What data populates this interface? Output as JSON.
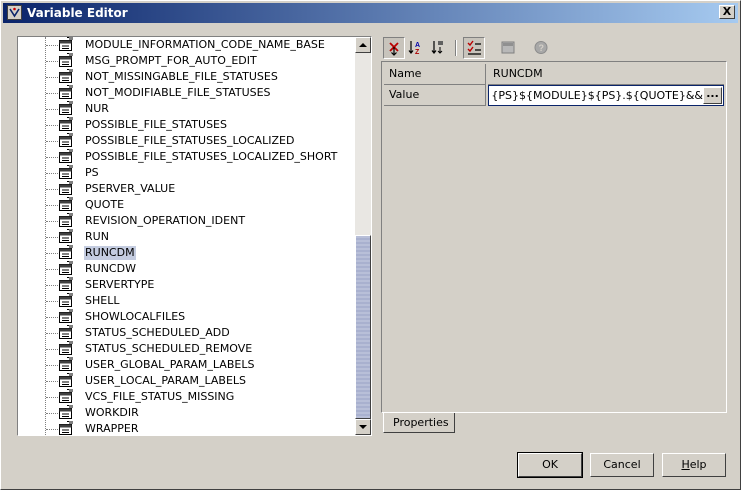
{
  "window": {
    "title": "Variable Editor",
    "close_glyph": "X"
  },
  "tree": {
    "items": [
      {
        "label": "MODULE_INFORMATION_CODE_NAME_BASE",
        "selected": false
      },
      {
        "label": "MSG_PROMPT_FOR_AUTO_EDIT",
        "selected": false
      },
      {
        "label": "NOT_MISSINGABLE_FILE_STATUSES",
        "selected": false
      },
      {
        "label": "NOT_MODIFIABLE_FILE_STATUSES",
        "selected": false
      },
      {
        "label": "NUR",
        "selected": false
      },
      {
        "label": "POSSIBLE_FILE_STATUSES",
        "selected": false
      },
      {
        "label": "POSSIBLE_FILE_STATUSES_LOCALIZED",
        "selected": false
      },
      {
        "label": "POSSIBLE_FILE_STATUSES_LOCALIZED_SHORT",
        "selected": false
      },
      {
        "label": "PS",
        "selected": false
      },
      {
        "label": "PSERVER_VALUE",
        "selected": false
      },
      {
        "label": "QUOTE",
        "selected": false
      },
      {
        "label": "REVISION_OPERATION_IDENT",
        "selected": false
      },
      {
        "label": "RUN",
        "selected": false
      },
      {
        "label": "RUNCDM",
        "selected": true
      },
      {
        "label": "RUNCDW",
        "selected": false
      },
      {
        "label": "SERVERTYPE",
        "selected": false
      },
      {
        "label": "SHELL",
        "selected": false
      },
      {
        "label": "SHOWLOCALFILES",
        "selected": false
      },
      {
        "label": "STATUS_SCHEDULED_ADD",
        "selected": false
      },
      {
        "label": "STATUS_SCHEDULED_REMOVE",
        "selected": false
      },
      {
        "label": "USER_GLOBAL_PARAM_LABELS",
        "selected": false
      },
      {
        "label": "USER_LOCAL_PARAM_LABELS",
        "selected": false
      },
      {
        "label": "VCS_FILE_STATUS_MISSING",
        "selected": false
      },
      {
        "label": "WORKDIR",
        "selected": false
      },
      {
        "label": "WRAPPER",
        "selected": false
      }
    ]
  },
  "toolbar": {
    "icons": [
      "sort-by-category-icon",
      "sort-by-name-icon",
      "sort-by-type-icon",
      "show-descriptions-icon",
      "customize-icon",
      "help-icon"
    ]
  },
  "properties": {
    "rows": [
      {
        "name": "Name",
        "value": "RUNCDM"
      },
      {
        "name": "Value",
        "value": ")TDIR}${PS}${MODULE}${PS}.${QUOTE}&&"
      }
    ],
    "ellipsis_label": "...",
    "tab_label": "Properties"
  },
  "buttons": {
    "ok": "OK",
    "cancel": "Cancel",
    "help_first": "H",
    "help_rest": "elp"
  },
  "colors": {
    "title_start": "#0a246a",
    "title_end": "#a6caf0",
    "selection": "#c4cce0",
    "face": "#d4d0c8"
  }
}
